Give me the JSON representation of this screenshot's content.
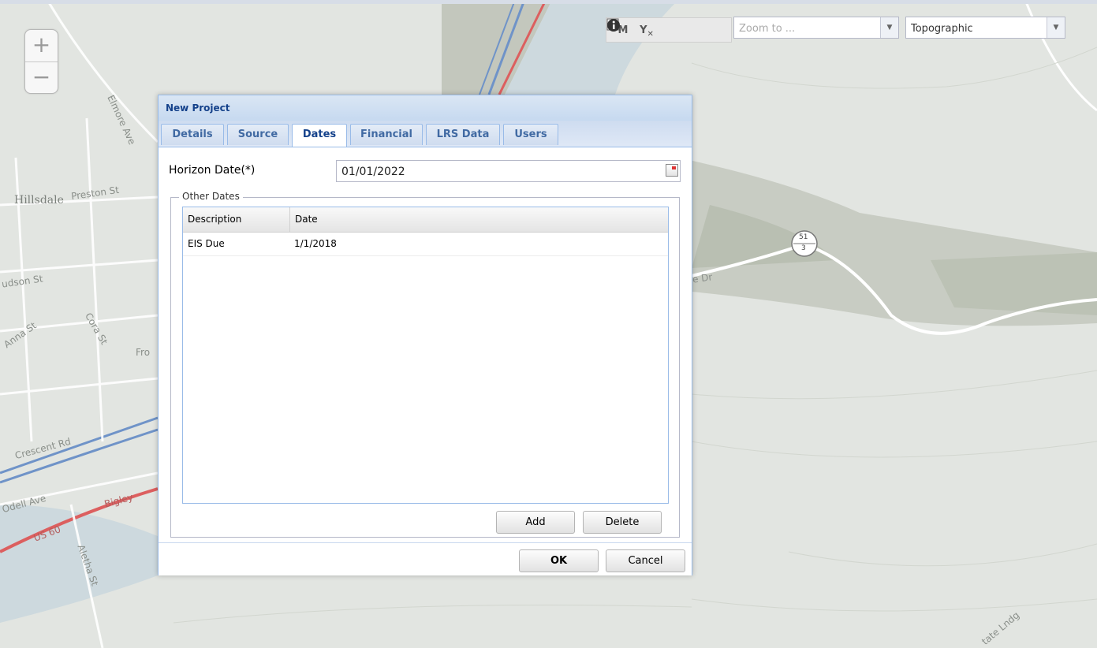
{
  "map": {
    "labels": {
      "hillsdale": "Hillsdale",
      "preston_st": "Preston St",
      "elmore_ave": "Elmore Ave",
      "hudson_st": "udson St",
      "anna_st": "Anna St",
      "cora_st": "Cora St",
      "fro": "Fro",
      "crescent_rd": "Crescent Rd",
      "odell_ave": "Odell Ave",
      "bigley": "Bigley",
      "us": "US 60",
      "aletha_st": "Aletha St",
      "route_top": "51",
      "route_bottom": "3",
      "dr": "e Dr",
      "state_ln": "tate Lndg"
    },
    "zoom": {
      "plus": "+",
      "minus": "−"
    },
    "toolbar": {
      "measure_label": "M",
      "clear_label": "Y",
      "zoom_to_placeholder": "Zoom to ...",
      "basemap_value": "Topographic"
    }
  },
  "dialog": {
    "title": "New Project",
    "tabs": [
      {
        "label": "Details",
        "active": false
      },
      {
        "label": "Source",
        "active": false
      },
      {
        "label": "Dates",
        "active": true
      },
      {
        "label": "Financial",
        "active": false
      },
      {
        "label": "LRS Data",
        "active": false
      },
      {
        "label": "Users",
        "active": false
      }
    ],
    "horizon_label": "Horizon Date(*)",
    "horizon_value": "01/01/2022",
    "other_dates": {
      "legend": "Other Dates",
      "columns": [
        "Description",
        "Date"
      ],
      "rows": [
        {
          "description": "EIS Due",
          "date": "1/1/2018"
        }
      ],
      "add_label": "Add",
      "delete_label": "Delete"
    },
    "ok_label": "OK",
    "cancel_label": "Cancel"
  },
  "colors": {
    "river": "#cdd9de",
    "road_blue": "#6f93c8",
    "road_red": "#dc5f5f",
    "header_blue": "#15428b"
  }
}
